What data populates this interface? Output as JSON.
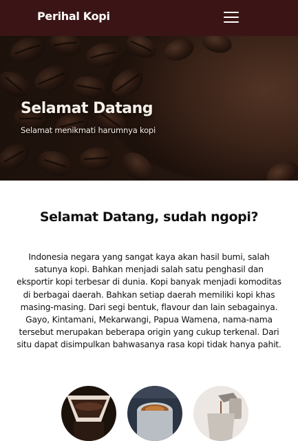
{
  "navbar": {
    "brand": "Perihal Kopi",
    "menu_icon": "hamburger-menu-icon"
  },
  "hero": {
    "title": "Selamat Datang",
    "subtitle": "Selamat menikmati harumnya kopi"
  },
  "intro": {
    "heading": "Selamat Datang, sudah ngopi?",
    "text": "Indonesia negara yang sangat kaya akan hasil bumi, salah satunya kopi. Bahkan menjadi salah satu penghasil dan eksportir kopi terbesar di dunia. Kopi banyak menjadi komoditas di berbagai daerah. Bahkan setiap daerah memiliki kopi khas masing-masing. Dari segi bentuk, flavour dan lain sebagainya. Gayo, Kintamani, Mekarwangi, Papua Wamena, nama-nama tersebut merupakan beberapa origin yang cukup terkenal. Dari situ dapat disimpulkan bahwasanya rasa kopi tidak hanya pahit."
  },
  "colors": {
    "navbar": "#3b1515",
    "hero_text": "#f6f0ea",
    "body_text": "#111111"
  }
}
